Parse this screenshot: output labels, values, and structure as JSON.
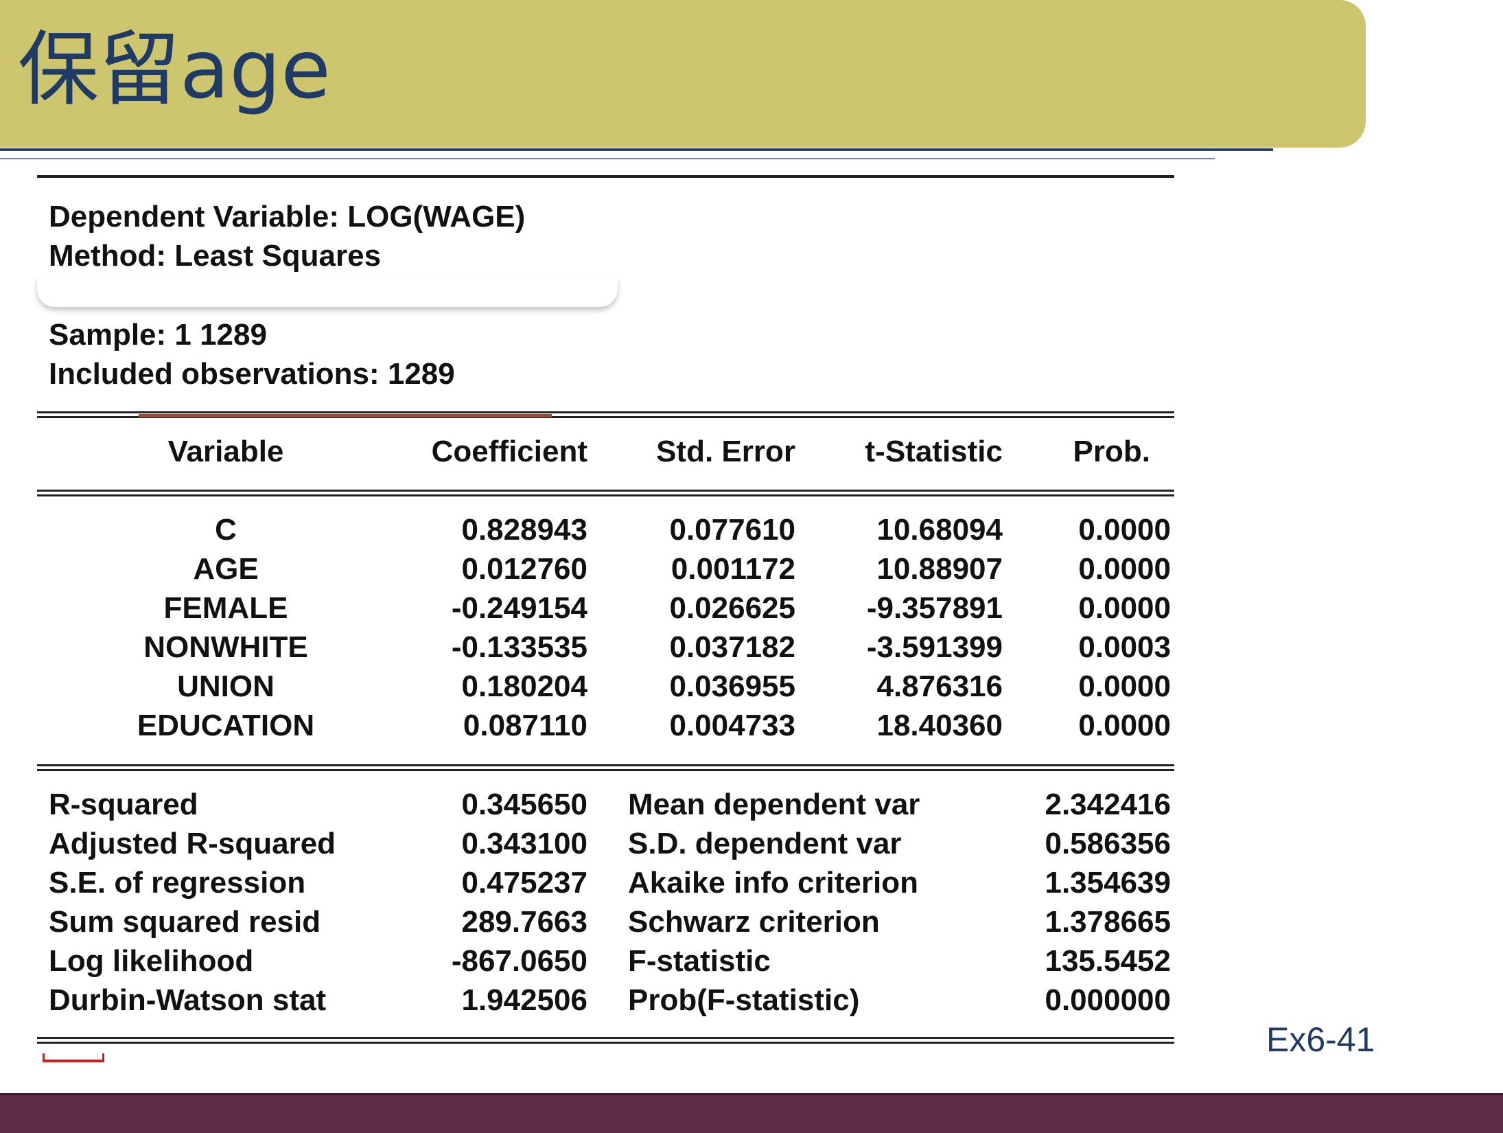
{
  "slide": {
    "title": "保留age",
    "slide_number": "Ex6-41",
    "colors": {
      "title_bar": "#cdc66f",
      "title_text": "#1f3a64",
      "footer": "#5b2b48",
      "age_underline": "#a4462b",
      "red_mark": "#d21e1e"
    }
  },
  "output": {
    "dependent_variable": "Dependent Variable: LOG(WAGE)",
    "method": "Method: Least Squares",
    "sample": "Sample: 1 1289",
    "included_observations": "Included observations: 1289",
    "headers": [
      "Variable",
      "Coefficient",
      "Std. Error",
      "t-Statistic",
      "Prob."
    ],
    "rows": [
      {
        "variable": "C",
        "coefficient": "0.828943",
        "std_error": "0.077610",
        "t_statistic": "10.68094",
        "prob": "0.0000"
      },
      {
        "variable": "AGE",
        "coefficient": "0.012760",
        "std_error": "0.001172",
        "t_statistic": "10.88907",
        "prob": "0.0000"
      },
      {
        "variable": "FEMALE",
        "coefficient": "-0.249154",
        "std_error": "0.026625",
        "t_statistic": "-9.357891",
        "prob": "0.0000"
      },
      {
        "variable": "NONWHITE",
        "coefficient": "-0.133535",
        "std_error": "0.037182",
        "t_statistic": "-3.591399",
        "prob": "0.0003"
      },
      {
        "variable": "UNION",
        "coefficient": "0.180204",
        "std_error": "0.036955",
        "t_statistic": "4.876316",
        "prob": "0.0000"
      },
      {
        "variable": "EDUCATION",
        "coefficient": "0.087110",
        "std_error": "0.004733",
        "t_statistic": "18.40360",
        "prob": "0.0000"
      }
    ],
    "stats": [
      {
        "label": "R-squared",
        "value": "0.345650",
        "label2": "Mean dependent var",
        "value2": "2.342416"
      },
      {
        "label": "Adjusted R-squared",
        "value": "0.343100",
        "label2": "S.D. dependent var",
        "value2": "0.586356"
      },
      {
        "label": "S.E. of regression",
        "value": "0.475237",
        "label2": "Akaike info criterion",
        "value2": "1.354639"
      },
      {
        "label": "Sum squared resid",
        "value": "289.7663",
        "label2": "Schwarz criterion",
        "value2": "1.378665"
      },
      {
        "label": "Log likelihood",
        "value": "-867.0650",
        "label2": "F-statistic",
        "value2": "135.5452"
      },
      {
        "label": "Durbin-Watson stat",
        "value": "1.942506",
        "label2": "Prob(F-statistic)",
        "value2": "0.000000"
      }
    ]
  }
}
